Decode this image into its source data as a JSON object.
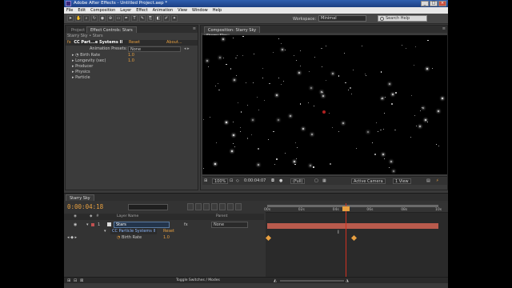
{
  "window": {
    "title": "Adobe After Effects - Untitled Project.aep *",
    "controls": [
      "_",
      "□",
      "×"
    ]
  },
  "menu": [
    "File",
    "Edit",
    "Composition",
    "Layer",
    "Effect",
    "Animation",
    "View",
    "Window",
    "Help"
  ],
  "toolbar": {
    "workspace_label": "Workspace:",
    "workspace_value": "Minimal",
    "search_placeholder": "Search Help"
  },
  "effect_panel": {
    "tabs": {
      "project": "Project",
      "effect_controls": "Effect Controls: Stars"
    },
    "breadcrumb": "Starry Sky • Stars",
    "effect_name": "CC Part...e Systems II",
    "effect_reset": "Reset",
    "effect_about": "About...",
    "presets_label": "Animation Presets:",
    "presets_value": "None",
    "properties": [
      {
        "name": "Birth Rate",
        "value": "1.0"
      },
      {
        "name": "Longevity (sec)",
        "value": "1.0"
      },
      {
        "name": "Producer",
        "value": ""
      },
      {
        "name": "Physics",
        "value": ""
      },
      {
        "name": "Particle",
        "value": ""
      }
    ]
  },
  "composition_panel": {
    "tab": "Composition: Starry Sky",
    "sub_tab": "Starry Sky",
    "footer": {
      "zoom": "100%",
      "timecode": "0:00:04:07",
      "resolution": "(Full)",
      "camera": "Active Camera",
      "views": "1 View"
    }
  },
  "timeline": {
    "tab": "Starry Sky",
    "timecode": "0:00:04:18",
    "columns": {
      "number": "#",
      "source": "Layer Name",
      "parent": "Parent"
    },
    "layers": [
      {
        "index": "1",
        "name": "Stars",
        "parent": "None"
      },
      {
        "index": "",
        "name": "CC Particle Systems II",
        "parent": "Reset"
      },
      {
        "index": "",
        "name": "Birth Rate",
        "parent": "1.0"
      }
    ],
    "ruler": [
      "00s",
      "02s",
      "04s",
      "06s",
      "08s",
      "10s"
    ],
    "footer": "Toggle Switches / Modes",
    "playhead_fraction": 0.46
  },
  "colors": {
    "accent": "#e8a040",
    "layer_bar": "#b85a4c",
    "playhead": "#d03020"
  }
}
